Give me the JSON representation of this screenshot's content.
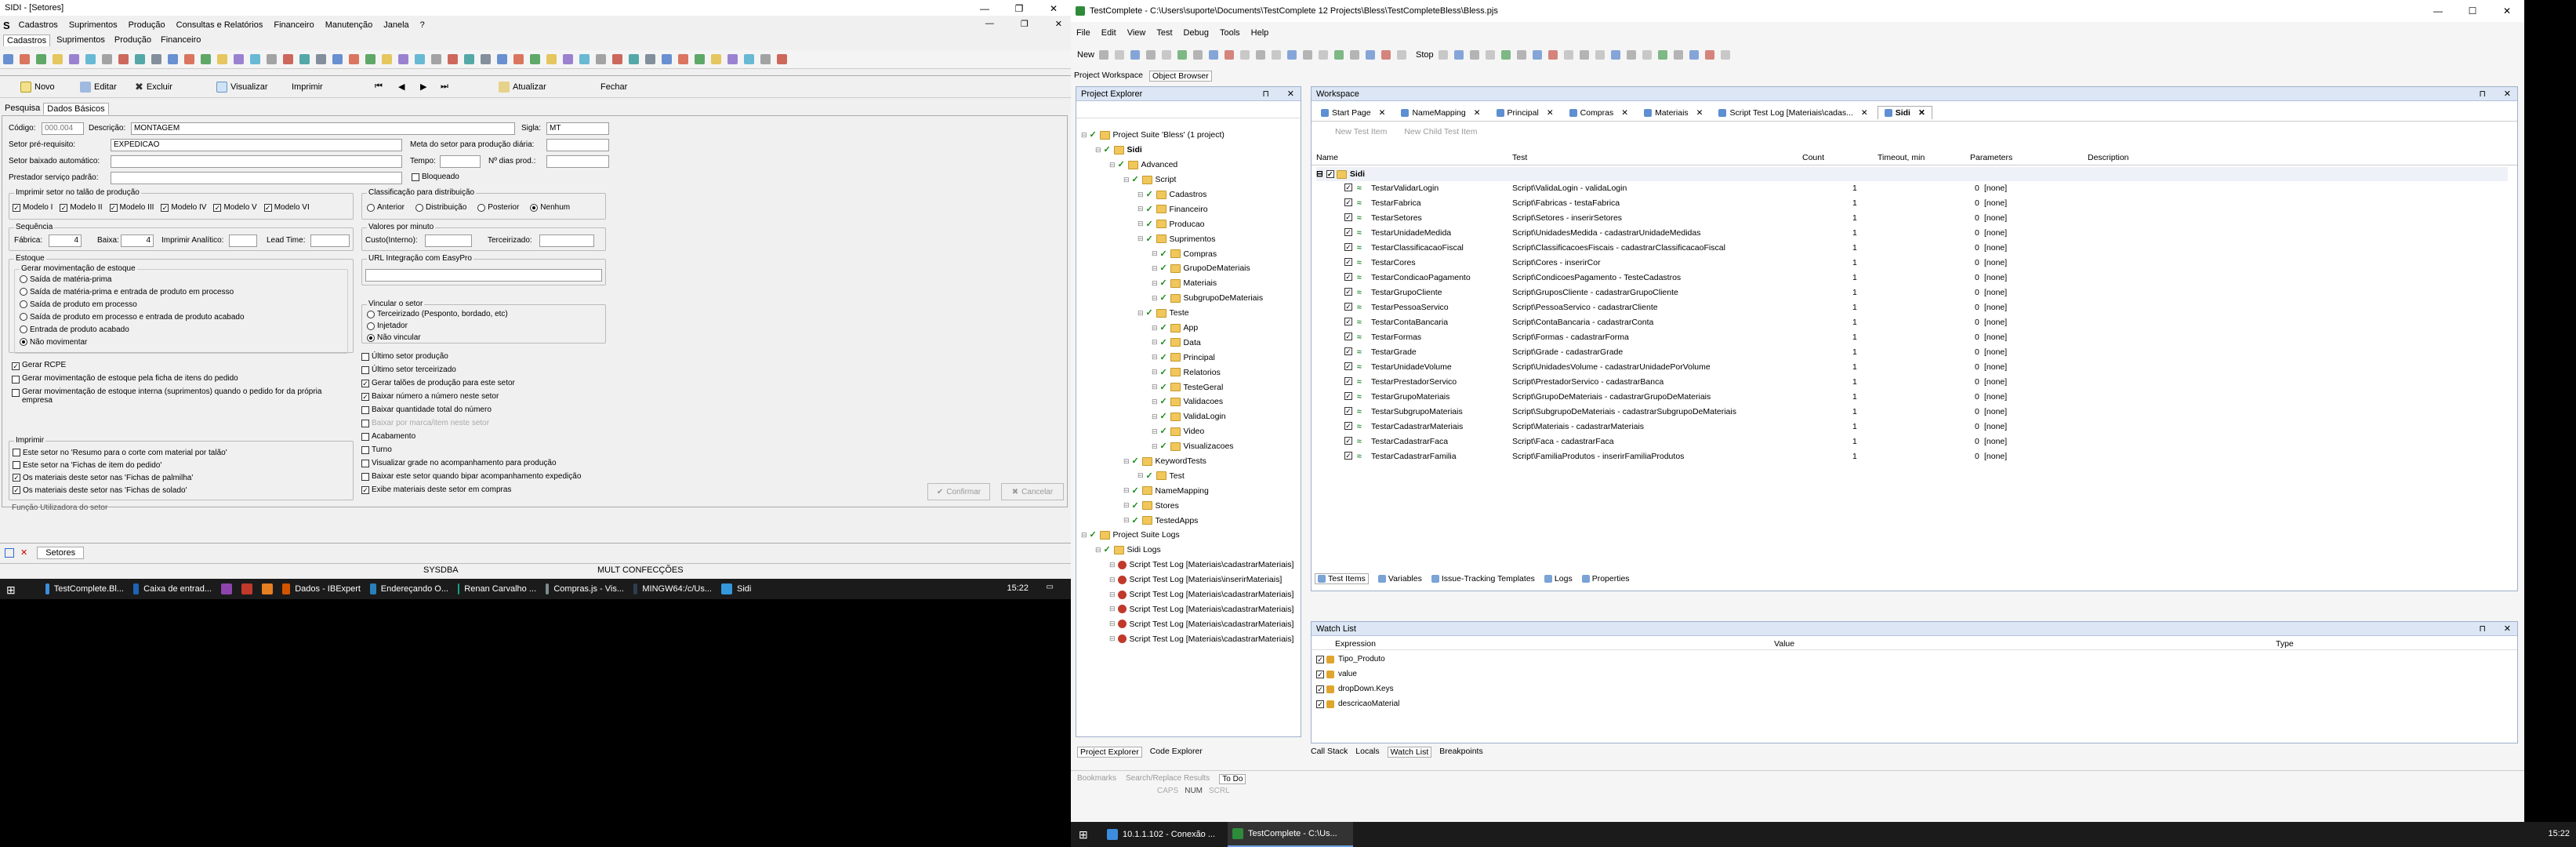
{
  "left_app": {
    "title": "SIDI - [Setores]",
    "menu": [
      "Cadastros",
      "Suprimentos",
      "Produção",
      "Consultas e Relatórios",
      "Financeiro",
      "Manutenção",
      "Janela",
      "?"
    ],
    "module_tabs": [
      "Cadastros",
      "Suprimentos",
      "Produção",
      "Financeiro"
    ],
    "actions": {
      "novo": "Novo",
      "editar": "Editar",
      "excluir": "Excluir",
      "visualizar": "Visualizar",
      "imprimir": "Imprimir",
      "atualizar": "Atualizar",
      "fechar": "Fechar"
    },
    "view_tabs": [
      "Pesquisa",
      "Dados Básicos"
    ],
    "fields": {
      "codigo_label": "Código:",
      "codigo": "000.004",
      "descricao_label": "Descrição:",
      "descricao": "MONTAGEM",
      "sigla_label": "Sigla:",
      "sigla": "MT",
      "setor_pre_label": "Setor pré-requisito:",
      "setor_pre": "EXPEDICAO",
      "meta_label": "Meta do setor para produção diária:",
      "setor_baixado_label": "Setor baixado automático:",
      "tempo_label": "Tempo:",
      "dias_label": "Nº dias prod.:",
      "prestador_label": "Prestador serviço padrão:",
      "bloqueado": "Bloqueado"
    },
    "imprimir_talao": {
      "legend": "Imprimir setor no talão de produção",
      "modelos": [
        "Modelo I",
        "Modelo II",
        "Modelo III",
        "Modelo IV",
        "Modelo V",
        "Modelo VI"
      ]
    },
    "classificacao": {
      "legend": "Classificação para distribuição",
      "opts": [
        "Anterior",
        "Distribuição",
        "Posterior",
        "Nenhum"
      ]
    },
    "sequencia": {
      "legend": "Sequência",
      "fabrica_label": "Fábrica:",
      "fabrica": "4",
      "baixa_label": "Baixa:",
      "baixa": "4",
      "analitico_label": "Imprimir Analítico:",
      "lead_label": "Lead Time:"
    },
    "valores": {
      "legend": "Valores por minuto",
      "custo_label": "Custo(Interno):",
      "terc_label": "Terceirizado:"
    },
    "estoque": {
      "legend": "Estoque",
      "sub_legend": "Gerar movimentação de estoque",
      "opts": [
        "Saída de matéria-prima",
        "Saída de matéria-prima e entrada de produto em processo",
        "Saída de produto em processo",
        "Saída de produto em processo e entrada de produto acabado",
        "Entrada de produto acabado",
        "Não movimentar"
      ],
      "checks": [
        "Gerar RCPE",
        "Gerar movimentação de estoque pela ficha de itens do pedido",
        "Gerar movimentação de estoque interna (suprimentos) quando o pedido for da própria empresa"
      ]
    },
    "url_easy": "URL Integração com EasyPro",
    "vincular": {
      "legend": "Vincular o setor",
      "opts": [
        "Terceirizado (Pesponto, bordado, etc)",
        "Injetador",
        "Não vincular"
      ]
    },
    "right_checks": [
      "Último setor produção",
      "Último setor terceirizado",
      "Gerar talões de produção para este setor",
      "Baixar número a número neste setor",
      "Baixar quantidade total do número",
      "Baixar por marca/item neste setor",
      "Acabamento",
      "Turno",
      "Visualizar grade no acompanhamento para produção",
      "Baixar este setor quando bipar acompanhamento expedição",
      "Exibe materiais deste setor em compras"
    ],
    "imprimir_sec": {
      "legend": "Imprimir",
      "checks": [
        "Este setor no 'Resumo para o corte com material por talão'",
        "Este setor na 'Fichas de item do pedido'",
        "Os materiais deste setor nas 'Fichas de palmilha'",
        "Os materiais deste setor nas 'Fichas de solado'"
      ]
    },
    "cut_label": "Função Utilizadora do setor",
    "btn_confirmar": "Confirmar",
    "btn_cancelar": "Cancelar",
    "mdi_tab": "Setores",
    "status": {
      "db": "SYSDBA",
      "company": "MULT CONFECÇÕES"
    }
  },
  "left_taskbar": {
    "items": [
      "TestComplete.Bl...",
      "Caixa de entrad...",
      "",
      "",
      "",
      "Dados - IBExpert",
      "Endereçando O...",
      "Renan Carvalho ...",
      "Compras.js - Vis...",
      "MINGW64:/c/Us...",
      "Sidi"
    ],
    "time": "15:22"
  },
  "tc": {
    "title": "TestComplete - C:\\Users\\suporte\\Documents\\TestComplete 12 Projects\\Bless\\TestCompleteBless\\Bless.pjs",
    "menu": [
      "File",
      "Edit",
      "View",
      "Test",
      "Debug",
      "Tools",
      "Help"
    ],
    "new_label": "New",
    "stop_label": "Stop",
    "top_tabs": [
      "Project Workspace",
      "Object Browser"
    ],
    "explorer_title": "Project Explorer",
    "workspace_title": "Workspace",
    "tree": [
      {
        "d": 0,
        "t": "Project Suite 'Bless' (1 project)"
      },
      {
        "d": 1,
        "t": "Sidi",
        "b": true
      },
      {
        "d": 2,
        "t": "Advanced"
      },
      {
        "d": 3,
        "t": "Script"
      },
      {
        "d": 4,
        "t": "Cadastros"
      },
      {
        "d": 4,
        "t": "Financeiro"
      },
      {
        "d": 4,
        "t": "Producao"
      },
      {
        "d": 4,
        "t": "Suprimentos"
      },
      {
        "d": 5,
        "t": "Compras"
      },
      {
        "d": 5,
        "t": "GrupoDeMateriais"
      },
      {
        "d": 5,
        "t": "Materiais"
      },
      {
        "d": 5,
        "t": "SubgrupoDeMateriais"
      },
      {
        "d": 4,
        "t": "Teste"
      },
      {
        "d": 5,
        "t": "App"
      },
      {
        "d": 5,
        "t": "Data"
      },
      {
        "d": 5,
        "t": "Principal"
      },
      {
        "d": 5,
        "t": "Relatorios"
      },
      {
        "d": 5,
        "t": "TesteGeral"
      },
      {
        "d": 5,
        "t": "Validacoes"
      },
      {
        "d": 5,
        "t": "ValidaLogin"
      },
      {
        "d": 5,
        "t": "Video"
      },
      {
        "d": 5,
        "t": "Visualizacoes"
      },
      {
        "d": 3,
        "t": "KeywordTests"
      },
      {
        "d": 4,
        "t": "Test"
      },
      {
        "d": 3,
        "t": "NameMapping"
      },
      {
        "d": 3,
        "t": "Stores"
      },
      {
        "d": 3,
        "t": "TestedApps"
      },
      {
        "d": 0,
        "t": "Project Suite Logs"
      },
      {
        "d": 1,
        "t": "Sidi Logs"
      },
      {
        "d": 2,
        "t": "Script Test Log [Materiais\\cadastrarMateriais]"
      },
      {
        "d": 2,
        "t": "Script Test Log [Materiais\\inserirMateriais]"
      },
      {
        "d": 2,
        "t": "Script Test Log [Materiais\\cadastrarMateriais]"
      },
      {
        "d": 2,
        "t": "Script Test Log [Materiais\\cadastrarMateriais]"
      },
      {
        "d": 2,
        "t": "Script Test Log [Materiais\\cadastrarMateriais]"
      },
      {
        "d": 2,
        "t": "Script Test Log [Materiais\\cadastrarMateriais]"
      }
    ],
    "ws_tabs": [
      "Start Page",
      "NameMapping",
      "Principal",
      "Compras",
      "Materiais",
      "Script Test Log [Materiais\\cadas...",
      "Sidi"
    ],
    "ws_toolbar": {
      "new": "New Test Item",
      "child": "New Child Test Item"
    },
    "grid_headers": [
      "Name",
      "Test",
      "Count",
      "Timeout, min",
      "Parameters",
      "Description"
    ],
    "grid_root": "Sidi",
    "grid_rows": [
      [
        "TestarValidarLogin",
        "Script\\ValidaLogin - validaLogin",
        "1",
        "0",
        "[none]"
      ],
      [
        "TestarFabrica",
        "Script\\Fabricas - testaFabrica",
        "1",
        "0",
        "[none]"
      ],
      [
        "TestarSetores",
        "Script\\Setores - inserirSetores",
        "1",
        "0",
        "[none]"
      ],
      [
        "TestarUnidadeMedida",
        "Script\\UnidadesMedida - cadastrarUnidadeMedidas",
        "1",
        "0",
        "[none]"
      ],
      [
        "TestarClassificacaoFiscal",
        "Script\\ClassificacoesFiscais - cadastrarClassificacaoFiscal",
        "1",
        "0",
        "[none]"
      ],
      [
        "TestarCores",
        "Script\\Cores - inserirCor",
        "1",
        "0",
        "[none]"
      ],
      [
        "TestarCondicaoPagamento",
        "Script\\CondicoesPagamento - TesteCadastros",
        "1",
        "0",
        "[none]"
      ],
      [
        "TestarGrupoCliente",
        "Script\\GruposCliente - cadastrarGrupoCliente",
        "1",
        "0",
        "[none]"
      ],
      [
        "TestarPessoaServico",
        "Script\\PessoaServico - cadastrarCliente",
        "1",
        "0",
        "[none]"
      ],
      [
        "TestarContaBancaria",
        "Script\\ContaBancaria - cadastrarConta",
        "1",
        "0",
        "[none]"
      ],
      [
        "TestarFormas",
        "Script\\Formas - cadastrarForma",
        "1",
        "0",
        "[none]"
      ],
      [
        "TestarGrade",
        "Script\\Grade - cadastrarGrade",
        "1",
        "0",
        "[none]"
      ],
      [
        "TestarUnidadeVolume",
        "Script\\UnidadesVolume - cadastrarUnidadePorVolume",
        "1",
        "0",
        "[none]"
      ],
      [
        "TestarPrestadorServico",
        "Script\\PrestadorServico - cadastrarBanca",
        "1",
        "0",
        "[none]"
      ],
      [
        "TestarGrupoMateriais",
        "Script\\GrupoDeMateriais - cadastrarGrupoDeMateriais",
        "1",
        "0",
        "[none]"
      ],
      [
        "TestarSubgrupoMateriais",
        "Script\\SubgrupoDeMateriais - cadastrarSubgrupoDeMateriais",
        "1",
        "0",
        "[none]"
      ],
      [
        "TestarCadastrarMateriais",
        "Script\\Materiais - cadastrarMateriais",
        "1",
        "0",
        "[none]"
      ],
      [
        "TestarCadastrarFaca",
        "Script\\Faca - cadastrarFaca",
        "1",
        "0",
        "[none]"
      ],
      [
        "TestarCadastrarFamilia",
        "Script\\FamiliaProdutos - inserirFamiliaProdutos",
        "1",
        "0",
        "[none]"
      ]
    ],
    "bottom_tabs": [
      "Test Items",
      "Variables",
      "Issue-Tracking Templates",
      "Logs",
      "Properties"
    ],
    "watch_title": "Watch List",
    "watch_headers": [
      "Expression",
      "Value",
      "Type"
    ],
    "watch_rows": [
      "Tipo_Produto",
      "value",
      "dropDown.Keys",
      "descricaoMaterial"
    ],
    "debug_tabs": [
      "Call Stack",
      "Locals",
      "Watch List",
      "Breakpoints"
    ],
    "explorer_tabs": [
      "Project Explorer",
      "Code Explorer"
    ],
    "status_tabs": [
      "Bookmarks",
      "Search/Replace Results",
      "To Do"
    ],
    "status_keys": [
      "CAPS",
      "NUM",
      "SCRL"
    ]
  },
  "right_taskbar": {
    "items": [
      "10.1.1.102 - Conexão ...",
      "TestComplete - C:\\Us..."
    ],
    "time": "15:22"
  }
}
